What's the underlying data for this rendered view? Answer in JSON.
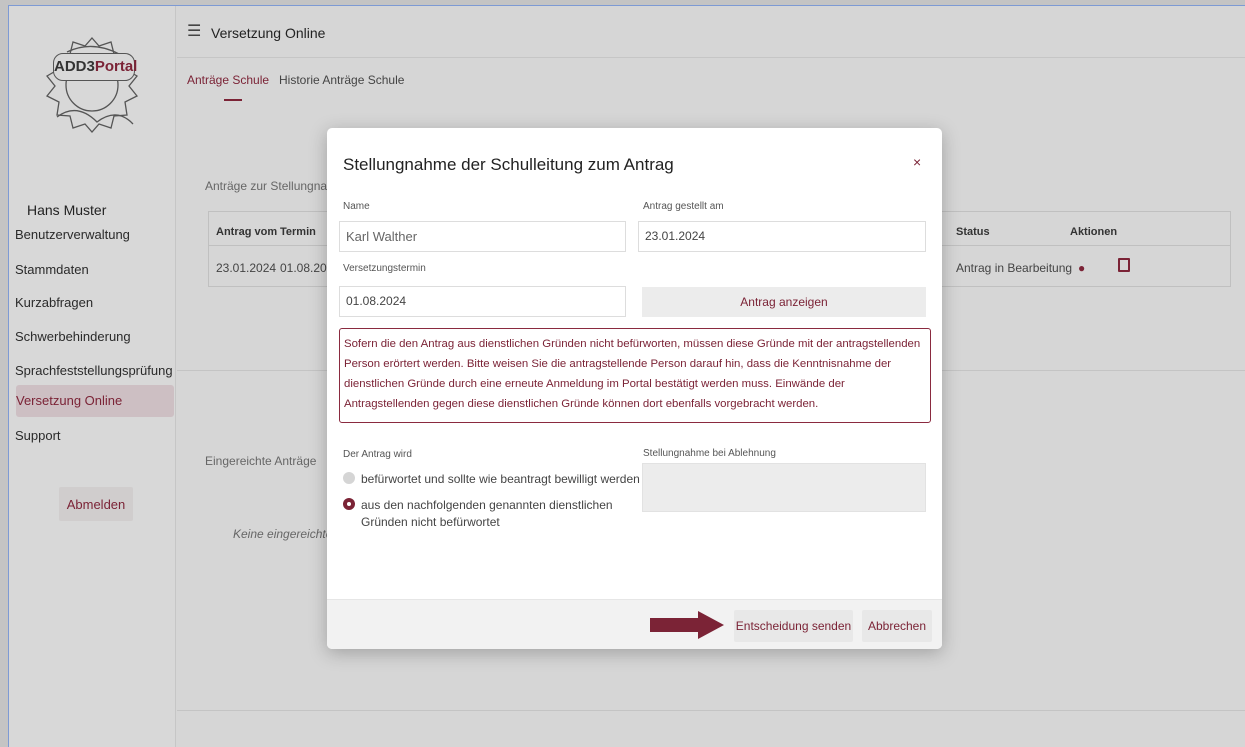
{
  "app": {
    "title": "Versetzung Online",
    "logo_text_prefix": "ADD3",
    "logo_text_suffix": "Portal"
  },
  "colors": {
    "accent": "#7b2336",
    "overlay_bg": "#d6d6d6"
  },
  "sidebar": {
    "user_name": "Hans Muster",
    "items": [
      {
        "label": "Benutzerverwaltung"
      },
      {
        "label": "Stammdaten"
      },
      {
        "label": "Kurzabfragen"
      },
      {
        "label": "Schwerbehinderung"
      },
      {
        "label": "Sprachfeststellungsprüfung"
      },
      {
        "label": "Versetzung Online"
      },
      {
        "label": "Support"
      }
    ],
    "logout_label": "Abmelden"
  },
  "tabs": [
    {
      "label": "Anträge Schule"
    },
    {
      "label": "Historie Anträge Schule"
    }
  ],
  "background": {
    "section1_title": "Anträge zur Stellungnahm",
    "table_headers": {
      "antrag_vom": "Antrag vom",
      "termin": "Termin",
      "status": "Status",
      "aktionen": "Aktionen"
    },
    "row": {
      "antrag_vom": "23.01.2024",
      "termin": "01.08.2024",
      "status": "Antrag in Bearbeitung"
    },
    "section2_title": "Eingereichte Anträge",
    "empty_text": "Keine eingereichten"
  },
  "modal": {
    "title": "Stellungnahme der Schulleitung zum Antrag",
    "close_label": "×",
    "name_label": "Name",
    "name_value": "Karl Walther",
    "date_label": "Antrag gestellt am",
    "date_value": "23.01.2024",
    "termin_label": "Versetzungstermin",
    "termin_value": "01.08.2024",
    "show_button": "Antrag anzeigen",
    "notice": "Sofern die den Antrag aus dienstlichen Gründen nicht befürworten, müssen diese Gründe mit der antragstellenden Person erörtert werden. Bitte weisen Sie die antragstellende Person darauf hin, dass die Kenntnisnahme der dienstlichen Gründe durch eine erneute Anmeldung im Portal bestätigt werden muss. Einwände der Antragstellenden gegen diese dienstlichen Gründe können dort ebenfalls vorgebracht werden.",
    "decision_label": "Der Antrag wird",
    "option1": "befürwortet und sollte wie beantragt bewilligt werden",
    "option2_line1": "aus den nachfolgenden genannten dienstlichen",
    "option2_line2": "Gründen nicht befürwortet",
    "selected_option": 2,
    "rejection_label": "Stellungnahme bei Ablehnung",
    "rejection_value": "",
    "send_button": "Entscheidung senden",
    "cancel_button": "Abbrechen"
  }
}
